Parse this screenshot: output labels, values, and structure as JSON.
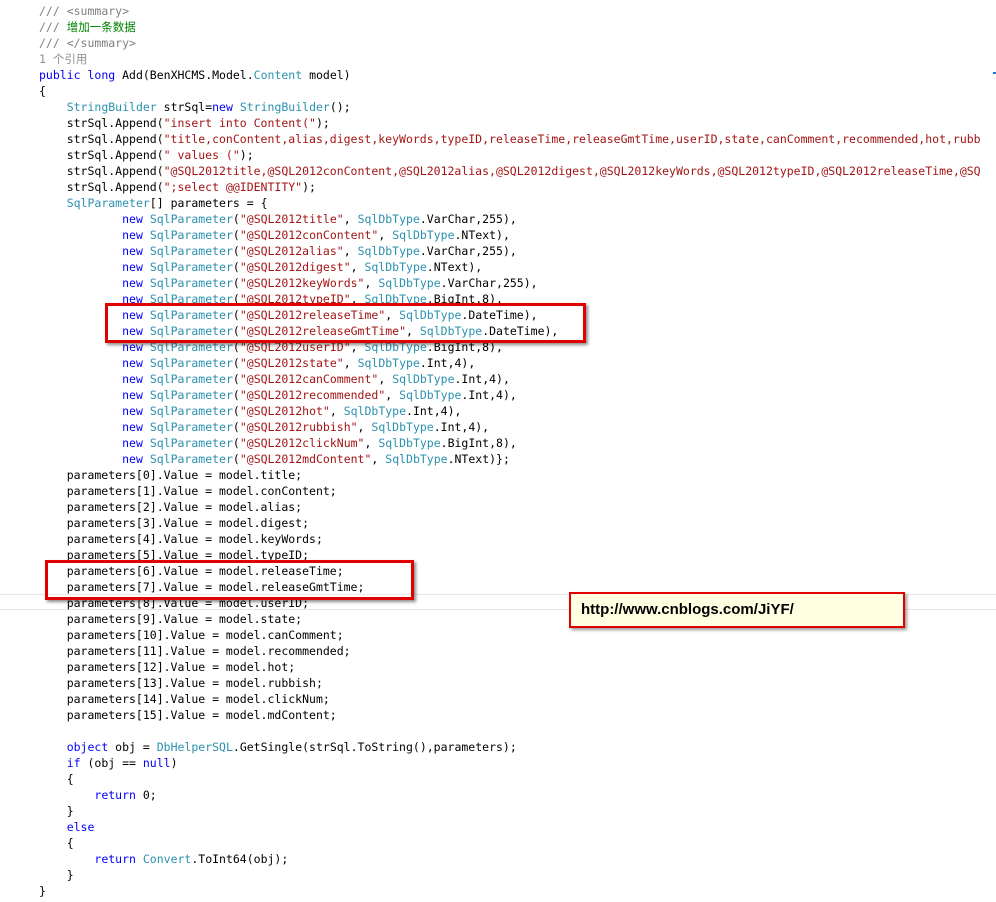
{
  "code": {
    "lines": [
      {
        "tokens": [
          {
            "c": "dc",
            "t": "/// "
          },
          {
            "c": "dc",
            "t": "<summary>"
          }
        ]
      },
      {
        "tokens": [
          {
            "c": "dc",
            "t": "/// "
          },
          {
            "c": "cm",
            "t": "增加一条数据"
          }
        ]
      },
      {
        "tokens": [
          {
            "c": "dc",
            "t": "/// "
          },
          {
            "c": "dc",
            "t": "</summary>"
          }
        ]
      },
      {
        "tokens": [
          {
            "c": "ref",
            "t": "1 个引用"
          }
        ]
      },
      {
        "tokens": [
          {
            "c": "kw",
            "t": "public"
          },
          {
            "t": " "
          },
          {
            "c": "kw",
            "t": "long"
          },
          {
            "t": " Add(BenXHCMS.Model."
          },
          {
            "c": "ty",
            "t": "Content"
          },
          {
            "t": " model)"
          }
        ]
      },
      {
        "tokens": [
          {
            "t": "{"
          }
        ]
      },
      {
        "tokens": [
          {
            "t": "    "
          },
          {
            "c": "ty",
            "t": "StringBuilder"
          },
          {
            "t": " strSql="
          },
          {
            "c": "kw",
            "t": "new"
          },
          {
            "t": " "
          },
          {
            "c": "ty",
            "t": "StringBuilder"
          },
          {
            "t": "();"
          }
        ]
      },
      {
        "tokens": [
          {
            "t": "    strSql.Append("
          },
          {
            "c": "st",
            "t": "\"insert into Content(\""
          },
          {
            "t": ");"
          }
        ]
      },
      {
        "tokens": [
          {
            "t": "    strSql.Append("
          },
          {
            "c": "st",
            "t": "\"title,conContent,alias,digest,keyWords,typeID,releaseTime,releaseGmtTime,userID,state,canComment,recommended,hot,rubb"
          }
        ]
      },
      {
        "tokens": [
          {
            "t": "    strSql.Append("
          },
          {
            "c": "st",
            "t": "\" values (\""
          },
          {
            "t": ");"
          }
        ]
      },
      {
        "tokens": [
          {
            "t": "    strSql.Append("
          },
          {
            "c": "st",
            "t": "\"@SQL2012title,@SQL2012conContent,@SQL2012alias,@SQL2012digest,@SQL2012keyWords,@SQL2012typeID,@SQL2012releaseTime,@SQ"
          }
        ]
      },
      {
        "tokens": [
          {
            "t": "    strSql.Append("
          },
          {
            "c": "st",
            "t": "\";select @@IDENTITY\""
          },
          {
            "t": ");"
          }
        ]
      },
      {
        "tokens": [
          {
            "t": "    "
          },
          {
            "c": "ty",
            "t": "SqlParameter"
          },
          {
            "t": "[] parameters = {"
          }
        ]
      },
      {
        "tokens": [
          {
            "t": "            "
          },
          {
            "c": "kw",
            "t": "new"
          },
          {
            "t": " "
          },
          {
            "c": "ty",
            "t": "SqlParameter"
          },
          {
            "t": "("
          },
          {
            "c": "st",
            "t": "\"@SQL2012title\""
          },
          {
            "t": ", "
          },
          {
            "c": "ty",
            "t": "SqlDbType"
          },
          {
            "t": ".VarChar,255),"
          }
        ]
      },
      {
        "tokens": [
          {
            "t": "            "
          },
          {
            "c": "kw",
            "t": "new"
          },
          {
            "t": " "
          },
          {
            "c": "ty",
            "t": "SqlParameter"
          },
          {
            "t": "("
          },
          {
            "c": "st",
            "t": "\"@SQL2012conContent\""
          },
          {
            "t": ", "
          },
          {
            "c": "ty",
            "t": "SqlDbType"
          },
          {
            "t": ".NText),"
          }
        ]
      },
      {
        "tokens": [
          {
            "t": "            "
          },
          {
            "c": "kw",
            "t": "new"
          },
          {
            "t": " "
          },
          {
            "c": "ty",
            "t": "SqlParameter"
          },
          {
            "t": "("
          },
          {
            "c": "st",
            "t": "\"@SQL2012alias\""
          },
          {
            "t": ", "
          },
          {
            "c": "ty",
            "t": "SqlDbType"
          },
          {
            "t": ".VarChar,255),"
          }
        ]
      },
      {
        "tokens": [
          {
            "t": "            "
          },
          {
            "c": "kw",
            "t": "new"
          },
          {
            "t": " "
          },
          {
            "c": "ty",
            "t": "SqlParameter"
          },
          {
            "t": "("
          },
          {
            "c": "st",
            "t": "\"@SQL2012digest\""
          },
          {
            "t": ", "
          },
          {
            "c": "ty",
            "t": "SqlDbType"
          },
          {
            "t": ".NText),"
          }
        ]
      },
      {
        "tokens": [
          {
            "t": "            "
          },
          {
            "c": "kw",
            "t": "new"
          },
          {
            "t": " "
          },
          {
            "c": "ty",
            "t": "SqlParameter"
          },
          {
            "t": "("
          },
          {
            "c": "st",
            "t": "\"@SQL2012keyWords\""
          },
          {
            "t": ", "
          },
          {
            "c": "ty",
            "t": "SqlDbType"
          },
          {
            "t": ".VarChar,255),"
          }
        ]
      },
      {
        "tokens": [
          {
            "t": "            "
          },
          {
            "c": "kw",
            "t": "new"
          },
          {
            "t": " "
          },
          {
            "c": "ty",
            "t": "SqlParameter"
          },
          {
            "t": "("
          },
          {
            "c": "st",
            "t": "\"@SQL2012typeID\""
          },
          {
            "t": ", "
          },
          {
            "c": "ty",
            "t": "SqlDbType"
          },
          {
            "t": ".BigInt,8),"
          }
        ]
      },
      {
        "tokens": [
          {
            "t": "            "
          },
          {
            "c": "kw",
            "t": "new"
          },
          {
            "t": " "
          },
          {
            "c": "ty",
            "t": "SqlParameter"
          },
          {
            "t": "("
          },
          {
            "c": "st",
            "t": "\"@SQL2012releaseTime\""
          },
          {
            "t": ", "
          },
          {
            "c": "ty",
            "t": "SqlDbType"
          },
          {
            "t": ".DateTime),"
          }
        ]
      },
      {
        "tokens": [
          {
            "t": "            "
          },
          {
            "c": "kw",
            "t": "new"
          },
          {
            "t": " "
          },
          {
            "c": "ty",
            "t": "SqlParameter"
          },
          {
            "t": "("
          },
          {
            "c": "st",
            "t": "\"@SQL2012releaseGmtTime\""
          },
          {
            "t": ", "
          },
          {
            "c": "ty",
            "t": "SqlDbType"
          },
          {
            "t": ".DateTime),"
          }
        ]
      },
      {
        "tokens": [
          {
            "t": "            "
          },
          {
            "c": "kw",
            "t": "new"
          },
          {
            "t": " "
          },
          {
            "c": "ty",
            "t": "SqlParameter"
          },
          {
            "t": "("
          },
          {
            "c": "st",
            "t": "\"@SQL2012userID\""
          },
          {
            "t": ", "
          },
          {
            "c": "ty",
            "t": "SqlDbType"
          },
          {
            "t": ".BigInt,8),"
          }
        ]
      },
      {
        "tokens": [
          {
            "t": "            "
          },
          {
            "c": "kw",
            "t": "new"
          },
          {
            "t": " "
          },
          {
            "c": "ty",
            "t": "SqlParameter"
          },
          {
            "t": "("
          },
          {
            "c": "st",
            "t": "\"@SQL2012state\""
          },
          {
            "t": ", "
          },
          {
            "c": "ty",
            "t": "SqlDbType"
          },
          {
            "t": ".Int,4),"
          }
        ]
      },
      {
        "tokens": [
          {
            "t": "            "
          },
          {
            "c": "kw",
            "t": "new"
          },
          {
            "t": " "
          },
          {
            "c": "ty",
            "t": "SqlParameter"
          },
          {
            "t": "("
          },
          {
            "c": "st",
            "t": "\"@SQL2012canComment\""
          },
          {
            "t": ", "
          },
          {
            "c": "ty",
            "t": "SqlDbType"
          },
          {
            "t": ".Int,4),"
          }
        ]
      },
      {
        "tokens": [
          {
            "t": "            "
          },
          {
            "c": "kw",
            "t": "new"
          },
          {
            "t": " "
          },
          {
            "c": "ty",
            "t": "SqlParameter"
          },
          {
            "t": "("
          },
          {
            "c": "st",
            "t": "\"@SQL2012recommended\""
          },
          {
            "t": ", "
          },
          {
            "c": "ty",
            "t": "SqlDbType"
          },
          {
            "t": ".Int,4),"
          }
        ]
      },
      {
        "tokens": [
          {
            "t": "            "
          },
          {
            "c": "kw",
            "t": "new"
          },
          {
            "t": " "
          },
          {
            "c": "ty",
            "t": "SqlParameter"
          },
          {
            "t": "("
          },
          {
            "c": "st",
            "t": "\"@SQL2012hot\""
          },
          {
            "t": ", "
          },
          {
            "c": "ty",
            "t": "SqlDbType"
          },
          {
            "t": ".Int,4),"
          }
        ]
      },
      {
        "tokens": [
          {
            "t": "            "
          },
          {
            "c": "kw",
            "t": "new"
          },
          {
            "t": " "
          },
          {
            "c": "ty",
            "t": "SqlParameter"
          },
          {
            "t": "("
          },
          {
            "c": "st",
            "t": "\"@SQL2012rubbish\""
          },
          {
            "t": ", "
          },
          {
            "c": "ty",
            "t": "SqlDbType"
          },
          {
            "t": ".Int,4),"
          }
        ]
      },
      {
        "tokens": [
          {
            "t": "            "
          },
          {
            "c": "kw",
            "t": "new"
          },
          {
            "t": " "
          },
          {
            "c": "ty",
            "t": "SqlParameter"
          },
          {
            "t": "("
          },
          {
            "c": "st",
            "t": "\"@SQL2012clickNum\""
          },
          {
            "t": ", "
          },
          {
            "c": "ty",
            "t": "SqlDbType"
          },
          {
            "t": ".BigInt,8),"
          }
        ]
      },
      {
        "tokens": [
          {
            "t": "            "
          },
          {
            "c": "kw",
            "t": "new"
          },
          {
            "t": " "
          },
          {
            "c": "ty",
            "t": "SqlParameter"
          },
          {
            "t": "("
          },
          {
            "c": "st",
            "t": "\"@SQL2012mdContent\""
          },
          {
            "t": ", "
          },
          {
            "c": "ty",
            "t": "SqlDbType"
          },
          {
            "t": ".NText)};"
          }
        ]
      },
      {
        "tokens": [
          {
            "t": "    parameters[0].Value = model.title;"
          }
        ]
      },
      {
        "tokens": [
          {
            "t": "    parameters[1].Value = model.conContent;"
          }
        ]
      },
      {
        "tokens": [
          {
            "t": "    parameters[2].Value = model.alias;"
          }
        ]
      },
      {
        "tokens": [
          {
            "t": "    parameters[3].Value = model.digest;"
          }
        ]
      },
      {
        "tokens": [
          {
            "t": "    parameters[4].Value = model.keyWords;"
          }
        ]
      },
      {
        "tokens": [
          {
            "t": "    parameters[5].Value = model.typeID;"
          }
        ]
      },
      {
        "tokens": [
          {
            "t": "    parameters[6].Value = model.releaseTime;"
          }
        ]
      },
      {
        "tokens": [
          {
            "t": "    parameters[7].Value = model.releaseGmtTime;"
          }
        ]
      },
      {
        "tokens": [
          {
            "t": "    parameters[8].Value = model.userID;"
          }
        ]
      },
      {
        "tokens": [
          {
            "t": "    parameters[9].Value = model.state;"
          }
        ]
      },
      {
        "tokens": [
          {
            "t": "    parameters[10].Value = model.canComment;"
          }
        ]
      },
      {
        "tokens": [
          {
            "t": "    parameters[11].Value = model.recommended;"
          }
        ]
      },
      {
        "tokens": [
          {
            "t": "    parameters[12].Value = model.hot;"
          }
        ]
      },
      {
        "tokens": [
          {
            "t": "    parameters[13].Value = model.rubbish;"
          }
        ]
      },
      {
        "tokens": [
          {
            "t": "    parameters[14].Value = model.clickNum;"
          }
        ]
      },
      {
        "tokens": [
          {
            "t": "    parameters[15].Value = model.mdContent;"
          }
        ]
      },
      {
        "tokens": [
          {
            "t": ""
          }
        ]
      },
      {
        "tokens": [
          {
            "t": "    "
          },
          {
            "c": "kw",
            "t": "object"
          },
          {
            "t": " obj = "
          },
          {
            "c": "ty",
            "t": "DbHelperSQL"
          },
          {
            "t": ".GetSingle(strSql.ToString(),parameters);"
          }
        ]
      },
      {
        "tokens": [
          {
            "t": "    "
          },
          {
            "c": "kw",
            "t": "if"
          },
          {
            "t": " (obj == "
          },
          {
            "c": "kw",
            "t": "null"
          },
          {
            "t": ")"
          }
        ]
      },
      {
        "tokens": [
          {
            "t": "    {"
          }
        ]
      },
      {
        "tokens": [
          {
            "t": "        "
          },
          {
            "c": "kw",
            "t": "return"
          },
          {
            "t": " 0;"
          }
        ]
      },
      {
        "tokens": [
          {
            "t": "    }"
          }
        ]
      },
      {
        "tokens": [
          {
            "t": "    "
          },
          {
            "c": "kw",
            "t": "else"
          }
        ]
      },
      {
        "tokens": [
          {
            "t": "    {"
          }
        ]
      },
      {
        "tokens": [
          {
            "t": "        "
          },
          {
            "c": "kw",
            "t": "return"
          },
          {
            "t": " "
          },
          {
            "c": "ty",
            "t": "Convert"
          },
          {
            "t": ".ToInt64(obj);"
          }
        ]
      },
      {
        "tokens": [
          {
            "t": "    }"
          }
        ]
      },
      {
        "tokens": [
          {
            "t": "}"
          }
        ]
      }
    ]
  },
  "watermark": {
    "text": "http://www.cnblogs.com/JiYF/"
  },
  "colors": {
    "keyword": "#0000ff",
    "type": "#2b91af",
    "string": "#a31515",
    "comment": "#008000",
    "doc": "#808080",
    "highlight": "#e00000",
    "watermark_bg": "#ffffe1"
  }
}
